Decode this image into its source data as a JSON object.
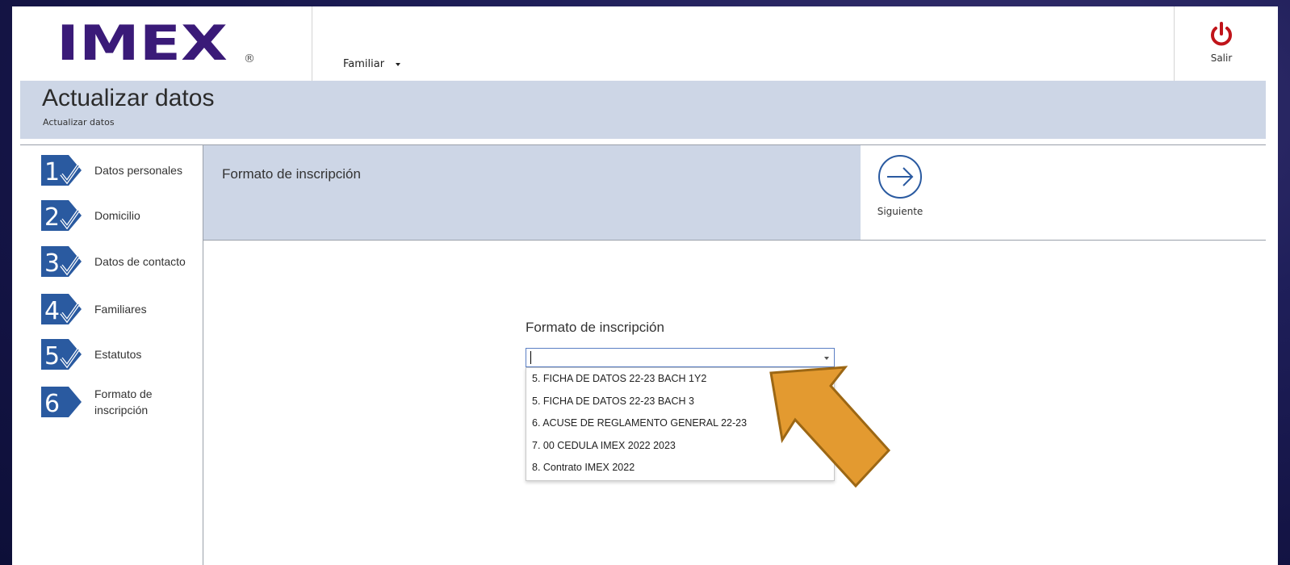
{
  "header": {
    "logo_text": "IMEX",
    "logo_mark": "®",
    "user_menu": "Familiar",
    "logout_label": "Salir",
    "logout_icon": "power-icon",
    "logout_color": "#c0141a"
  },
  "title_band": {
    "title": "Actualizar datos",
    "subtitle": "Actualizar datos"
  },
  "steps": [
    {
      "number": "1",
      "label": "Datos personales",
      "completed": true
    },
    {
      "number": "2",
      "label": "Domicilio",
      "completed": true
    },
    {
      "number": "3",
      "label": "Datos de contacto",
      "completed": true
    },
    {
      "number": "4",
      "label": "Familiares",
      "completed": true
    },
    {
      "number": "5",
      "label": "Estatutos",
      "completed": true
    },
    {
      "number": "6",
      "label": "Formato de inscripción",
      "completed": false
    }
  ],
  "form_header": {
    "title": "Formato de inscripción",
    "next_label": "Siguiente",
    "next_icon": "arrow-right-circle-icon"
  },
  "form": {
    "field_label": "Formato de inscripción",
    "field_value": "",
    "options": [
      "5. FICHA DE DATOS 22-23 BACH 1Y2",
      "5. FICHA DE DATOS 22-23 BACH 3",
      "6. ACUSE DE REGLAMENTO GENERAL 22-23",
      "7. 00 CEDULA IMEX 2022 2023",
      "8. Contrato IMEX 2022"
    ]
  },
  "colors": {
    "brand": "#3a1a78",
    "step_badge": "#2a5aa0",
    "band": "#cdd6e6",
    "annotation_arrow": "#e39a30"
  }
}
